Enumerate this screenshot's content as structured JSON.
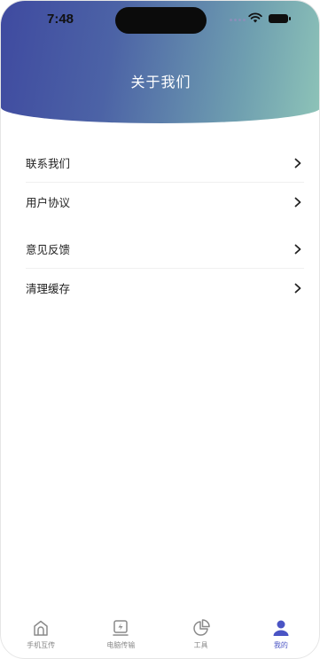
{
  "status_bar": {
    "time": "7:48"
  },
  "header": {
    "title": "关于我们"
  },
  "menu": {
    "group1": [
      {
        "label": "联系我们"
      },
      {
        "label": "用户协议"
      }
    ],
    "group2": [
      {
        "label": "意见反馈"
      },
      {
        "label": "清理缓存"
      }
    ]
  },
  "tabbar": {
    "items": [
      {
        "label": "手机互传",
        "icon": "home-transfer-icon"
      },
      {
        "label": "电脑传输",
        "icon": "computer-transfer-icon"
      },
      {
        "label": "工具",
        "icon": "tools-chart-icon"
      },
      {
        "label": "我的",
        "icon": "profile-icon"
      }
    ],
    "active_color": "#4a54c4",
    "inactive_color": "#8a8a8a"
  },
  "colors": {
    "header_gradient_start": "#3f4aa0",
    "header_gradient_end": "#8ec4b8"
  }
}
